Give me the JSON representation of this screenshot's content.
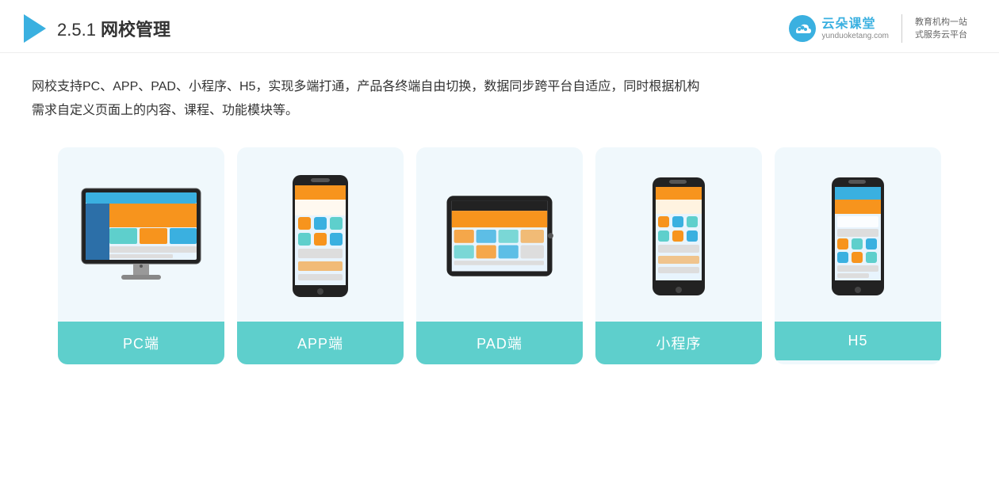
{
  "header": {
    "title_prefix": "2.5.1 ",
    "title_bold": "网校管理",
    "brand_name": "云朵课堂",
    "brand_url": "yunduoketang.com",
    "brand_slogan_line1": "教育机构一站",
    "brand_slogan_line2": "式服务云平台"
  },
  "description": {
    "line1": "网校支持PC、APP、PAD、小程序、H5，实现多端打通，产品各终端自由切换，数据同步跨平台自适应，同时根据机构",
    "line2": "需求自定义页面上的内容、课程、功能模块等。"
  },
  "cards": [
    {
      "id": "pc",
      "label": "PC端",
      "type": "pc"
    },
    {
      "id": "app",
      "label": "APP端",
      "type": "phone"
    },
    {
      "id": "pad",
      "label": "PAD端",
      "type": "pad"
    },
    {
      "id": "miniapp",
      "label": "小程序",
      "type": "phone"
    },
    {
      "id": "h5",
      "label": "H5",
      "type": "phone"
    }
  ]
}
